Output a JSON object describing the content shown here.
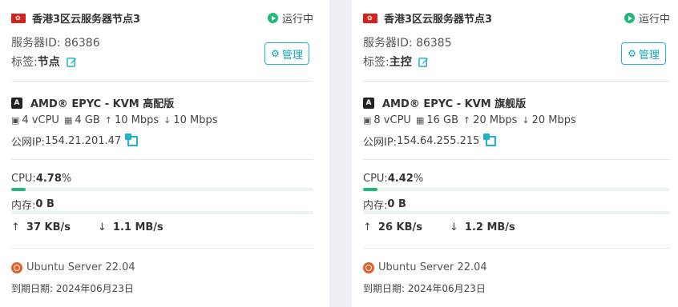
{
  "servers": [
    {
      "title": "香港3区云服务器节点3",
      "status": "运行中",
      "server_id": "服务器ID: 86386",
      "tag_label": "标签: ",
      "tag_value": "节点",
      "manage_label": "管理",
      "cpu_model": "AMD® EPYC - KVM 高配版",
      "vcpu": "4 vCPU",
      "ram": "4 GB",
      "up_bw": "10 Mbps",
      "down_bw": "10 Mbps",
      "ip_label": "公网IP: ",
      "ip": "154.21.201.47",
      "cpu_label": "CPU: ",
      "cpu_value": "4.78",
      "cpu_unit": " %",
      "cpu_fill": 0.0478,
      "mem_label": "内存: ",
      "mem_value": "0 B",
      "mem_fill": 0,
      "net_up": "37 KB/s",
      "net_down": "1.1 MB/s",
      "os": "Ubuntu Server 22.04",
      "expiry": "到期日期: 2024年06月23日"
    },
    {
      "title": "香港3区云服务器节点3",
      "status": "运行中",
      "server_id": "服务器ID: 86385",
      "tag_label": "标签: ",
      "tag_value": "主控",
      "manage_label": "管理",
      "cpu_model": "AMD® EPYC - KVM 旗舰版",
      "vcpu": "8 vCPU",
      "ram": "16 GB",
      "up_bw": "20 Mbps",
      "down_bw": "20 Mbps",
      "ip_label": "公网IP: ",
      "ip": "154.64.255.215",
      "cpu_label": "CPU: ",
      "cpu_value": "4.42",
      "cpu_unit": " %",
      "cpu_fill": 0.0442,
      "mem_label": "内存: ",
      "mem_value": "0 B",
      "mem_fill": 0,
      "net_up": "26 KB/s",
      "net_down": "1.2 MB/s",
      "os": "Ubuntu Server 22.04",
      "expiry": "到期日期: 2024年06月23日"
    }
  ],
  "icons": {
    "flag": "hong-kong-flag-icon",
    "status": "play-circle-icon",
    "edit": "edit-icon",
    "manage": "gear-icon",
    "cpu_brand": "amd-badge-icon",
    "copy": "copy-icon",
    "os": "ubuntu-icon"
  },
  "colors": {
    "accent": "#1fb5c9",
    "running": "#20b979",
    "flag": "#d6211c",
    "ubuntu": "#e85f27"
  }
}
